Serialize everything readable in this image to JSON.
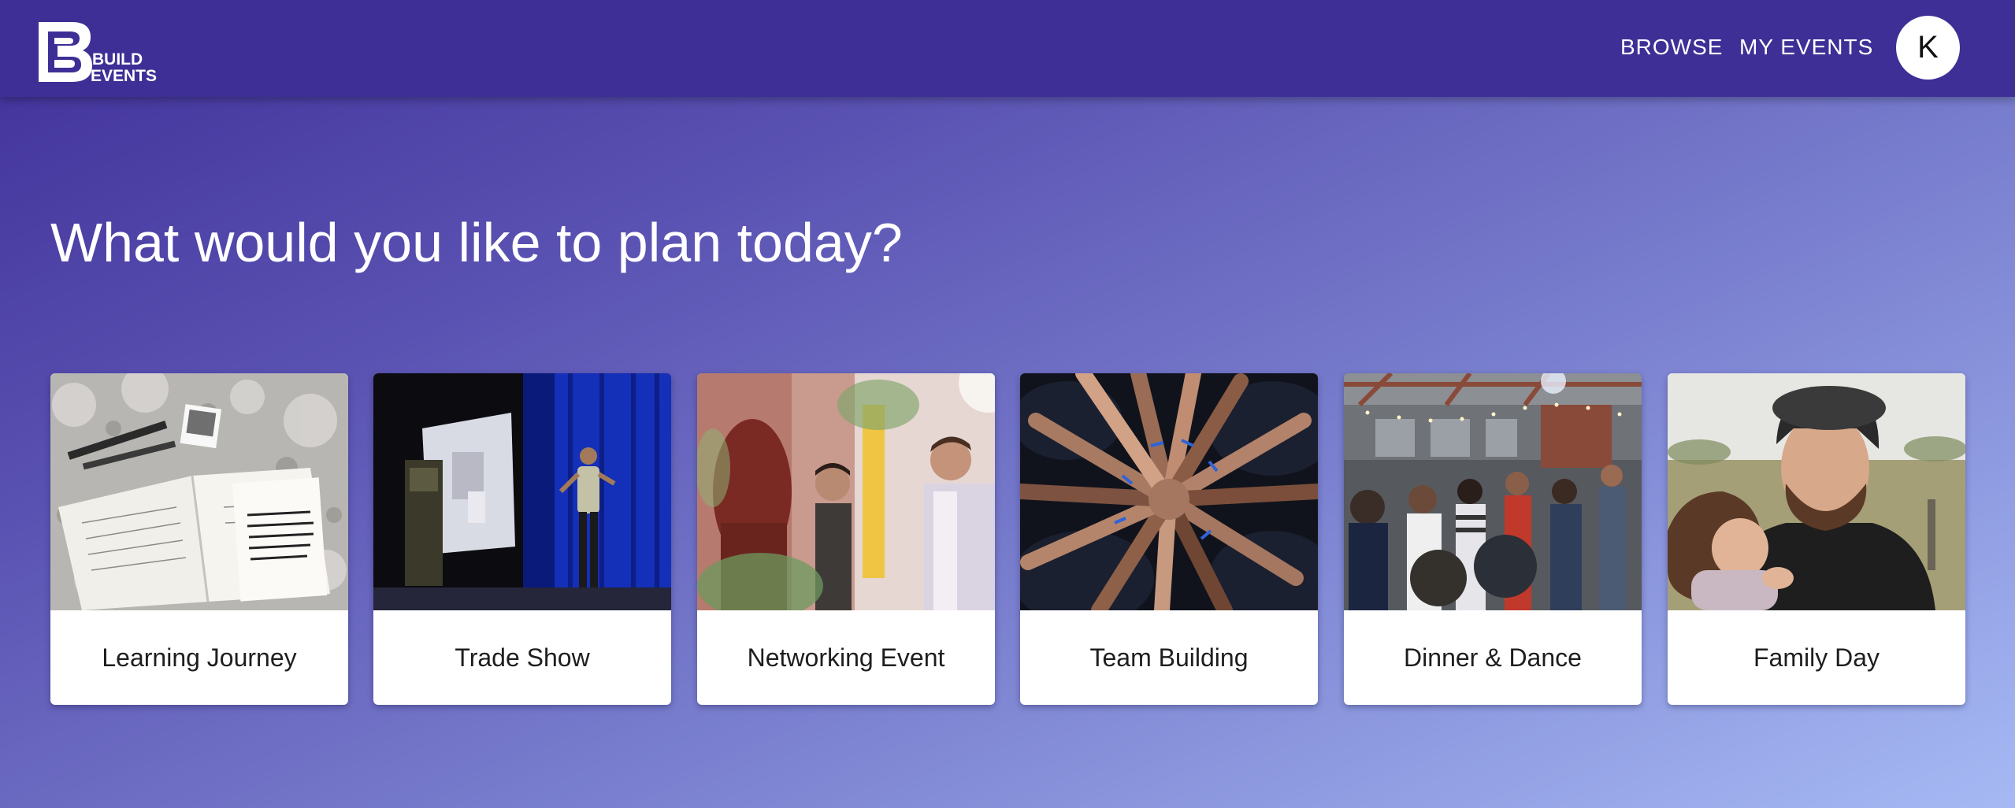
{
  "brand": {
    "logo_letter": "B",
    "logo_word1": "BUILD",
    "logo_word2": "EVENTS"
  },
  "nav": {
    "browse": "BROWSE",
    "my_events": "MY EVENTS",
    "avatar_initial": "K"
  },
  "main": {
    "headline": "What would you like to plan today?"
  },
  "event_types": [
    {
      "label": "Learning Journey"
    },
    {
      "label": "Trade Show"
    },
    {
      "label": "Networking Event"
    },
    {
      "label": "Team Building"
    },
    {
      "label": "Dinner & Dance"
    },
    {
      "label": "Family Day"
    }
  ],
  "colors": {
    "app_bar": "#3d2f96",
    "gradient_start": "#3f2f98",
    "gradient_end": "#a6b9f4",
    "card_background": "#ffffff",
    "text_on_dark": "#ffffff"
  }
}
